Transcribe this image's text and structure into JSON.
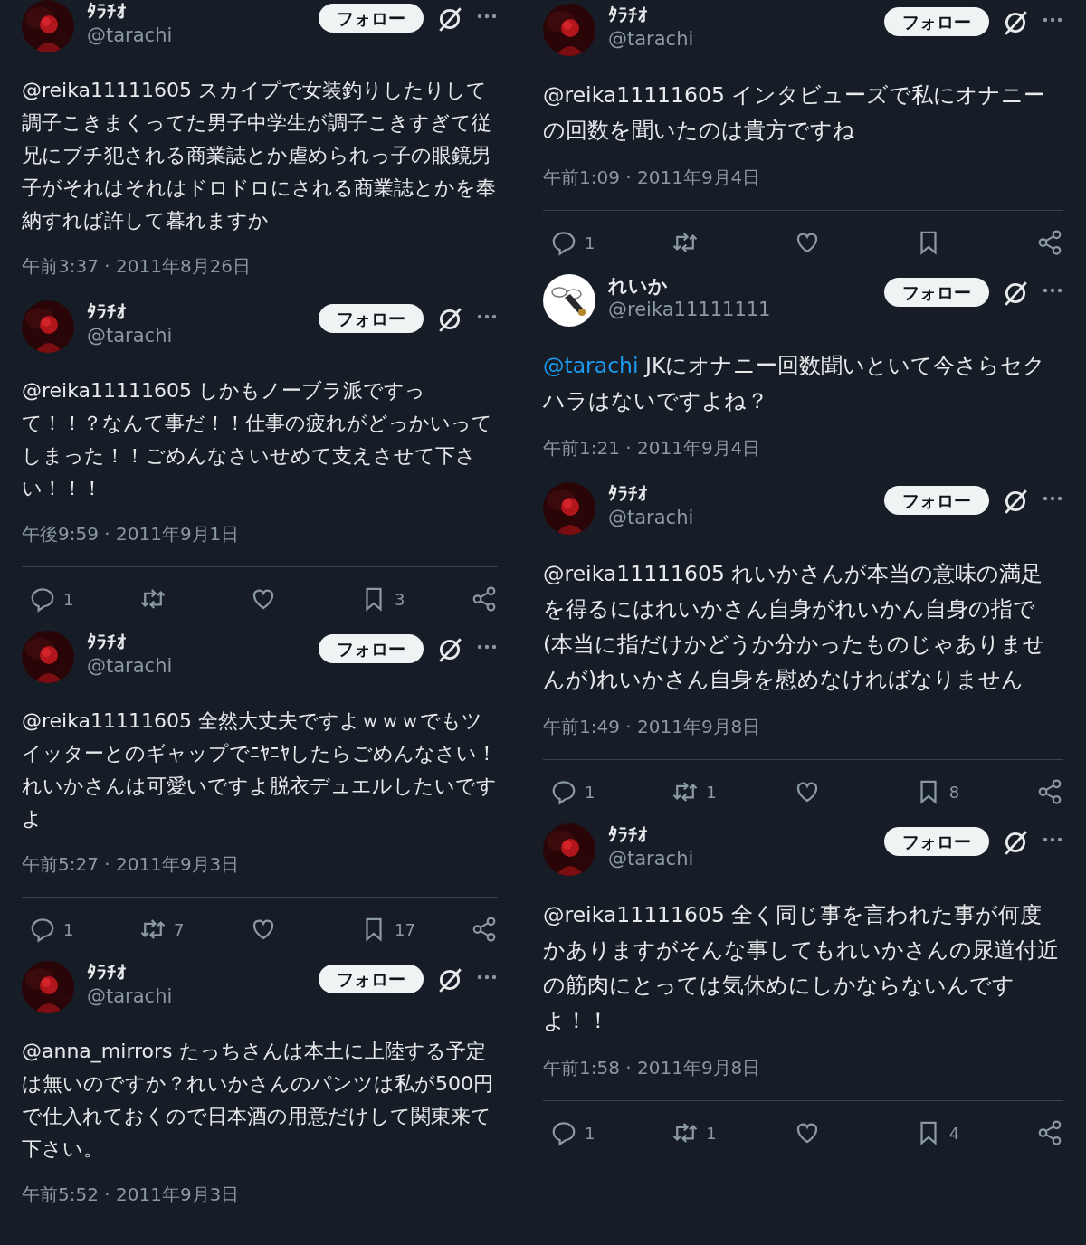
{
  "columns": [
    {
      "tweets": [
        {
          "name": "ﾀﾗﾁｵ",
          "handle": "@tarachi",
          "follow": "フォロー",
          "text": "@reika11111605 スカイプで女装釣りしたりして調子こきまくってた男子中学生が調子こきすぎて従兄にブチ犯される商業誌とか虐められっ子の眼鏡男子がそれはそれはドロドロにされる商業誌とかを奉納すれば許して暮れますか",
          "time": "午前3:37 · 2011年8月26日"
        },
        {
          "name": "ﾀﾗﾁｵ",
          "handle": "@tarachi",
          "follow": "フォロー",
          "text": "@reika11111605 しかもノーブラ派ですって！！？なんて事だ！！仕事の疲れがどっかいってしまった！！ごめんなさいせめて支えさせて下さい！！！",
          "time": "午後9:59 · 2011年9月1日",
          "actions": {
            "replies": "1",
            "bookmarks": "3"
          }
        },
        {
          "name": "ﾀﾗﾁｵ",
          "handle": "@tarachi",
          "follow": "フォロー",
          "text": "@reika11111605 全然大丈夫ですよｗｗｗでもツイッターとのギャップでﾆﾔﾆﾔしたらごめんなさい！れいかさんは可愛いですよ脱衣デュエルしたいですよ",
          "time": "午前5:27 · 2011年9月3日",
          "actions": {
            "replies": "1",
            "reposts": "7",
            "bookmarks": "17"
          }
        },
        {
          "name": "ﾀﾗﾁｵ",
          "handle": "@tarachi",
          "follow": "フォロー",
          "text": "@anna_mirrors たっちさんは本土に上陸する予定は無いのですか？れいかさんのパンツは私が500円で仕入れておくので日本酒の用意だけして関東来て下さい。",
          "time": "午前5:52 · 2011年9月3日"
        }
      ]
    },
    {
      "tweets": [
        {
          "name": "ﾀﾗﾁｵ",
          "handle": "@tarachi",
          "follow": "フォロー",
          "text": "@reika11111605 インタビューズで私にオナニーの回数を聞いたのは貴方ですね",
          "time": "午前1:09 · 2011年9月4日",
          "actions": {
            "replies": "1"
          }
        },
        {
          "name": "れいか",
          "handle": "@reika11111111",
          "follow": "フォロー",
          "link": "@tarachi",
          "text": " JKにオナニー回数聞いといて今さらセクハラはないですよね？",
          "time": "午前1:21 · 2011年9月4日"
        },
        {
          "name": "ﾀﾗﾁｵ",
          "handle": "@tarachi",
          "follow": "フォロー",
          "text": "@reika11111605 れいかさんが本当の意味の満足を得るにはれいかさん自身がれいかん自身の指で(本当に指だけかどうか分かったものじゃありませんが)れいかさん自身を慰めなければなりません",
          "time": "午前1:49 · 2011年9月8日",
          "actions": {
            "replies": "1",
            "reposts": "1",
            "bookmarks": "8"
          }
        },
        {
          "name": "ﾀﾗﾁｵ",
          "handle": "@tarachi",
          "follow": "フォロー",
          "text": "@reika11111605 全く同じ事を言われた事が何度かありますがそんな事してもれいかさんの尿道付近の筋肉にとっては気休めにしかならないんですよ！！",
          "time": "午前1:58 · 2011年9月8日",
          "actions": {
            "replies": "1",
            "reposts": "1",
            "bookmarks": "4"
          }
        }
      ]
    }
  ]
}
